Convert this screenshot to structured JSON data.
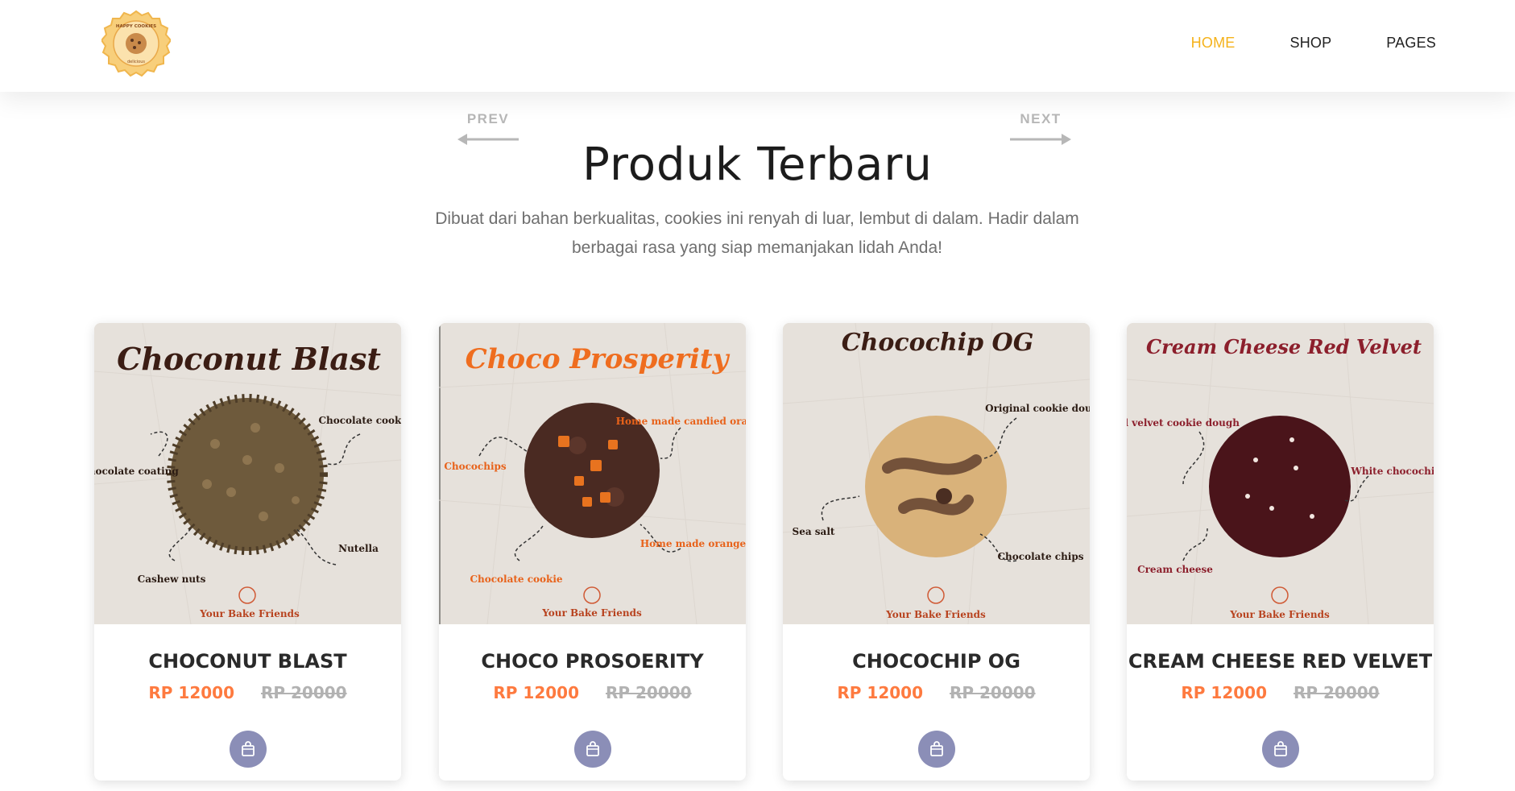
{
  "nav": {
    "items": [
      "HOME",
      "SHOP",
      "PAGES"
    ],
    "active": "HOME"
  },
  "logo": {
    "text_top": "HAPPY COOKIES",
    "text_bottom": "delicious"
  },
  "slider": {
    "prev": "PREV",
    "next": "NEXT"
  },
  "section": {
    "title": "Produk Terbaru",
    "subtitle_line1": "Dibuat dari bahan berkualitas, cookies ini renyah di luar, lembut di dalam. Hadir dalam",
    "subtitle_line2": "berbagai rasa yang siap memanjakan lidah Anda!"
  },
  "products": [
    {
      "name": "CHOCONUT BLAST",
      "price": "RP 12000",
      "old_price": "RP 20000",
      "image_title": "Choconut Blast",
      "annotations": [
        "Chocolate cookie",
        "Chocolate coating",
        "Nutella",
        "Cashew nuts"
      ],
      "brand": "Your Bake Friends",
      "title_color": "#3b1d14",
      "cookie_color": "#6e5a3c"
    },
    {
      "name": "CHOCO PROSOERITY",
      "price": "RP 12000",
      "old_price": "RP 20000",
      "image_title": "Choco Prosperity",
      "annotations": [
        "Home made candied orange peel",
        "Chocochips",
        "Home made orange jam",
        "Chocolate cookie"
      ],
      "brand": "Your Bake Friends",
      "title_color": "#ef6d1f",
      "cookie_color": "#4a2a22"
    },
    {
      "name": "CHOCOCHIP OG",
      "price": "RP 12000",
      "old_price": "RP 20000",
      "image_title": "Chocochip OG",
      "annotations": [
        "Original cookie dough",
        "Sea salt",
        "Chocolate chips"
      ],
      "brand": "Your Bake Friends",
      "title_color": "#3b1d14",
      "cookie_color": "#d9b27a"
    },
    {
      "name": "CREAM CHEESE RED VELVET",
      "price": "RP 12000",
      "old_price": "RP 20000",
      "image_title": "Cream Cheese Red Velvet",
      "annotations": [
        "Red velvet cookie dough",
        "White chocochips",
        "Cream cheese"
      ],
      "brand": "Your Bake Friends",
      "title_color": "#8c1f2c",
      "cookie_color": "#4a141a"
    }
  ],
  "colors": {
    "accent": "#f5b21a",
    "price": "#fe7a3f",
    "cart_button": "#8b8eb7"
  }
}
